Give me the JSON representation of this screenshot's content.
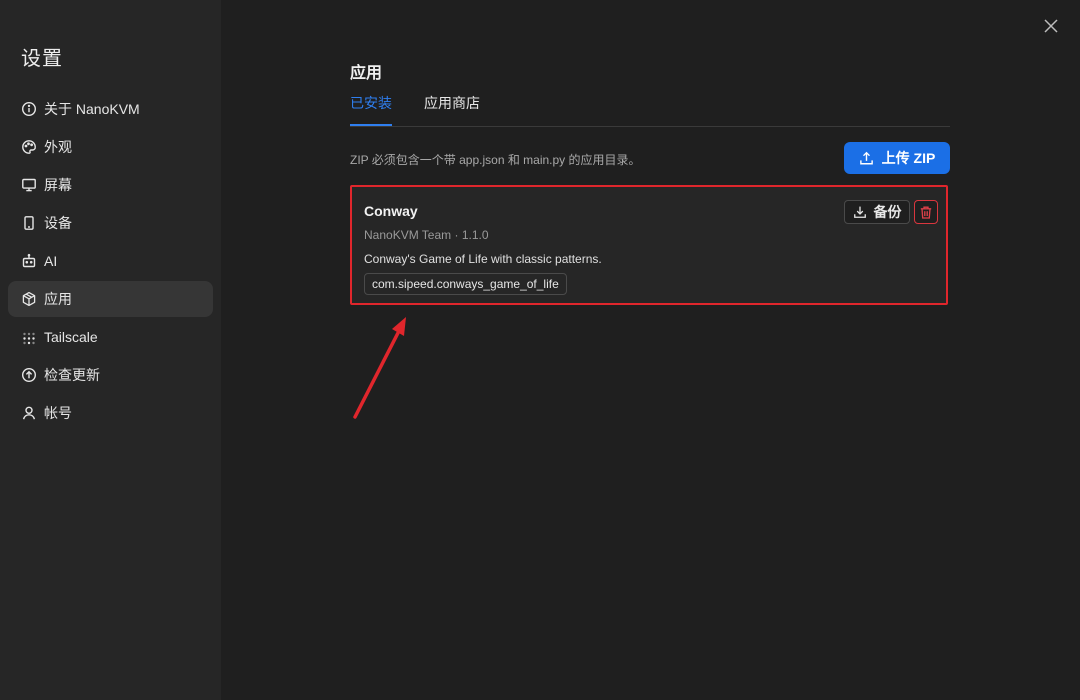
{
  "sidebar": {
    "title": "设置",
    "items": [
      {
        "label": "关于 NanoKVM",
        "icon": "info-icon"
      },
      {
        "label": "外观",
        "icon": "palette-icon"
      },
      {
        "label": "屏幕",
        "icon": "monitor-icon"
      },
      {
        "label": "设备",
        "icon": "device-icon"
      },
      {
        "label": "AI",
        "icon": "robot-icon"
      },
      {
        "label": "应用",
        "icon": "package-icon",
        "active": true
      },
      {
        "label": "Tailscale",
        "icon": "tailscale-icon"
      },
      {
        "label": "检查更新",
        "icon": "update-icon"
      },
      {
        "label": "帐号",
        "icon": "user-icon"
      }
    ]
  },
  "main": {
    "title": "应用",
    "tabs": [
      {
        "label": "已安装",
        "active": true
      },
      {
        "label": "应用商店"
      }
    ],
    "hint": "ZIP 必须包含一个带 app.json 和 main.py 的应用目录。",
    "upload_label": "上传 ZIP",
    "apps": [
      {
        "name": "Conway",
        "meta": "NanoKVM Team · 1.1.0",
        "description": "Conway's Game of Life with classic patterns.",
        "id": "com.sipeed.conways_game_of_life",
        "backup_label": "备份"
      }
    ]
  },
  "colors": {
    "accent": "#1b6fe6",
    "danger": "#d9363e",
    "highlight": "#e0262c"
  }
}
